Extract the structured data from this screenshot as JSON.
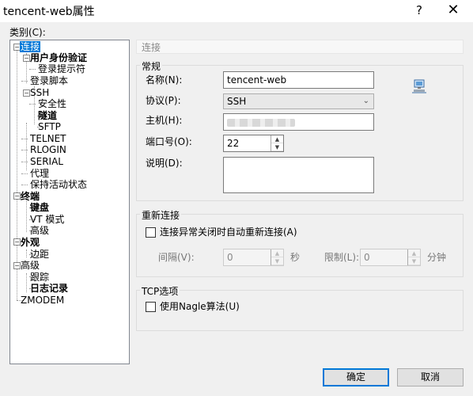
{
  "window": {
    "title": "tencent-web属性",
    "help_glyph": "?",
    "close_glyph": "✕"
  },
  "category_label": "类别(C):",
  "tree": {
    "items": [
      {
        "label": "连接",
        "selected": true,
        "bold": false
      },
      {
        "label": "用户身份验证",
        "bold": true
      },
      {
        "label": "登录提示符"
      },
      {
        "label": "登录脚本"
      },
      {
        "label": "SSH"
      },
      {
        "label": "安全性"
      },
      {
        "label": "隧道",
        "bold": true
      },
      {
        "label": "SFTP"
      },
      {
        "label": "TELNET"
      },
      {
        "label": "RLOGIN"
      },
      {
        "label": "SERIAL"
      },
      {
        "label": "代理"
      },
      {
        "label": "保持活动状态"
      },
      {
        "label": "终端",
        "bold": true
      },
      {
        "label": "键盘",
        "bold": true
      },
      {
        "label": "VT 模式"
      },
      {
        "label": "高级"
      },
      {
        "label": "外观",
        "bold": true
      },
      {
        "label": "边距"
      },
      {
        "label": "高级"
      },
      {
        "label": "跟踪"
      },
      {
        "label": "日志记录",
        "bold": true
      },
      {
        "label": "ZMODEM"
      }
    ]
  },
  "panel": {
    "header": "连接",
    "general": {
      "title": "常规",
      "name_label": "名称(N):",
      "name_value": "tencent-web",
      "protocol_label": "协议(P):",
      "protocol_value": "SSH",
      "host_label": "主机(H):",
      "port_label": "端口号(O):",
      "port_value": "22",
      "desc_label": "说明(D):",
      "desc_value": ""
    },
    "reconnect": {
      "title": "重新连接",
      "auto_label": "连接异常关闭时自动重新连接(A)",
      "interval_label": "间隔(V):",
      "interval_value": "0",
      "interval_unit": "秒",
      "limit_label": "限制(L):",
      "limit_value": "0",
      "limit_unit": "分钟"
    },
    "tcp": {
      "title": "TCP选项",
      "nagle_label": "使用Nagle算法(U)"
    }
  },
  "buttons": {
    "ok": "确定",
    "cancel": "取消"
  }
}
